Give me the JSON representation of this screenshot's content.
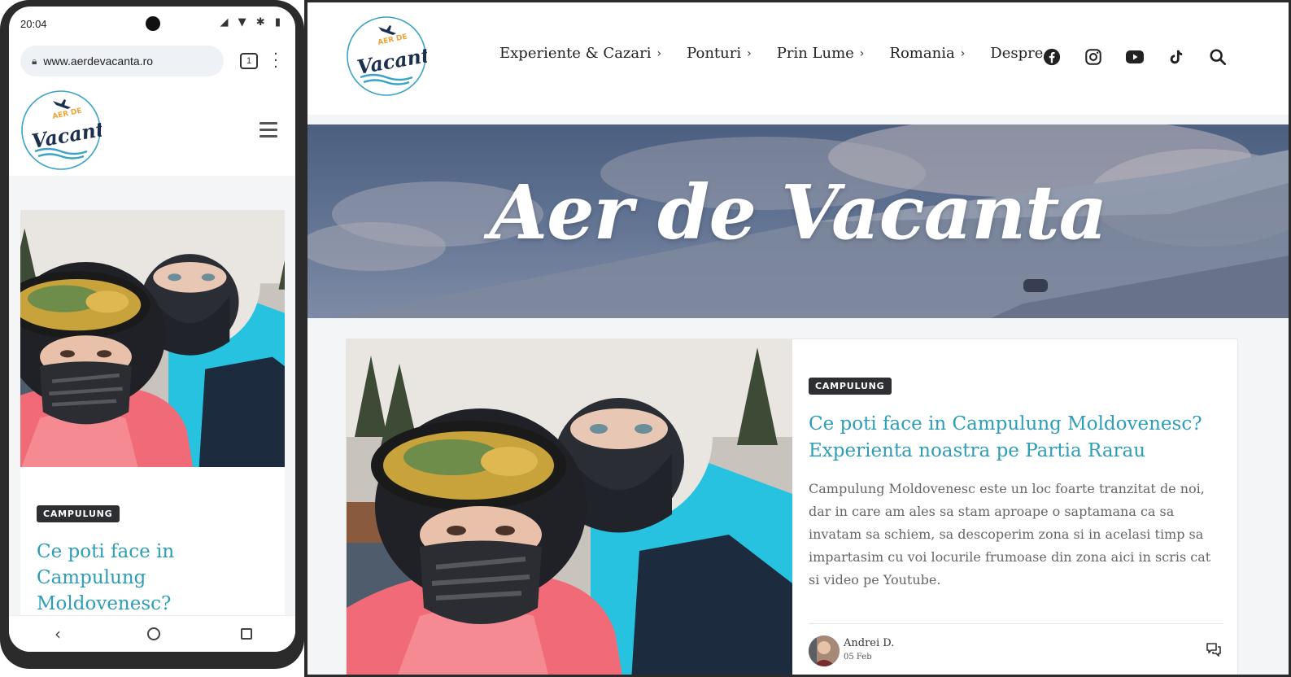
{
  "phone": {
    "status": {
      "time": "20:04",
      "icons": "◢ ▼ ✱ ▮"
    },
    "browser": {
      "url": "www.aerdevacanta.ro",
      "tab_count": "1"
    },
    "site": {
      "logo": {
        "text_top": "AER DE",
        "text_main": "Vacanta"
      },
      "post": {
        "category": "CAMPULUNG",
        "title": "Ce poti face in Campulung Moldovenesc?"
      }
    }
  },
  "desktop": {
    "logo": {
      "text_top": "AER DE",
      "text_main": "Vacanta"
    },
    "nav": [
      {
        "label": "Experiente & Cazari",
        "has_submenu": true
      },
      {
        "label": "Ponturi",
        "has_submenu": true
      },
      {
        "label": "Prin Lume",
        "has_submenu": true
      },
      {
        "label": "Romania",
        "has_submenu": true
      },
      {
        "label": "Despre",
        "has_submenu": false
      }
    ],
    "social_icons": [
      "facebook-icon",
      "instagram-icon",
      "youtube-icon",
      "tiktok-icon",
      "search-icon"
    ],
    "hero": {
      "title": "Aer de Vacanta"
    },
    "post": {
      "category": "CAMPULUNG",
      "title": "Ce poti face in Campulung Moldovenesc? Experienta noastra pe Partia Rarau",
      "excerpt": "Campulung Moldovenesc este un loc foarte tranzitat de noi, dar in care am ales sa stam aproape o saptamana ca sa invatam sa schiem, sa descoperim zona si in acelasi timp sa impartasim cu voi locurile frumoase din zona aici in scris cat si video pe Youtube.",
      "author": "Andrei D.",
      "date": "05 Feb"
    }
  },
  "colors": {
    "accent": "#2d9db8",
    "badge_bg": "#2e2f33",
    "page_bg": "#f4f5f7",
    "logo_orange": "#f0a53a",
    "logo_navy": "#1d2f4f"
  }
}
